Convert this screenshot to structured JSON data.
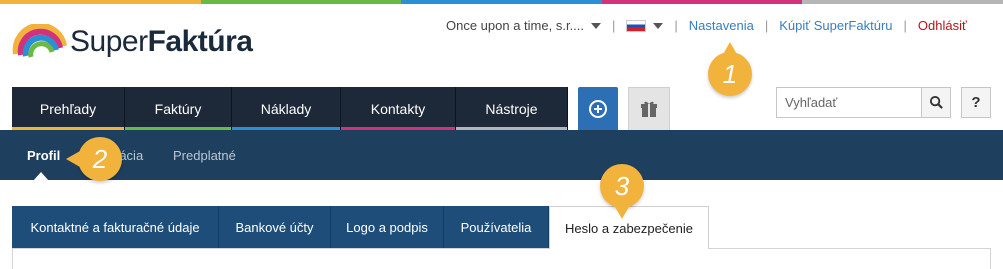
{
  "brand": {
    "name_light": "Super",
    "name_bold": "Faktúra",
    "stripe_colors": [
      "#f2b33d",
      "#6ab945",
      "#2b8fd6",
      "#d2327a",
      "#b5b5b5"
    ]
  },
  "topnav": {
    "company": "Once upon a time, s.r....",
    "separator": "|",
    "language_flag": "slovakia-flag-icon",
    "settings": "Nastavenia",
    "buy": "Kúpiť SuperFaktúru",
    "logout": "Odhlásiť"
  },
  "callouts": [
    "1",
    "2",
    "3"
  ],
  "mainnav": [
    {
      "label": "Prehľady",
      "color": "#f2b33d"
    },
    {
      "label": "Faktúry",
      "color": "#6ab945"
    },
    {
      "label": "Náklady",
      "color": "#2b8fd6"
    },
    {
      "label": "Kontakty",
      "color": "#d2327a"
    },
    {
      "label": "Nástroje",
      "color": "#b5b5b5"
    }
  ],
  "actions": {
    "add_icon": "plus-circle-icon",
    "gift_icon": "gift-icon"
  },
  "search": {
    "placeholder": "Vyhľadať",
    "icon": "search-icon"
  },
  "help": {
    "label": "?"
  },
  "subnav": {
    "items": [
      "Profil",
      "Integrácia",
      "Predplatné"
    ],
    "visible_fragment": "rácia",
    "active": "Profil"
  },
  "tabs": {
    "items": [
      "Kontaktné a fakturačné údaje",
      "Bankové účty",
      "Logo a podpis",
      "Používatelia",
      "Heslo a zabezpečenie"
    ],
    "active": "Heslo a zabezpečenie"
  },
  "colors": {
    "nav_dark": "#1d2838",
    "subbar": "#1e3f5e",
    "tab_blue": "#1e4d7a",
    "accent_blue": "#2c6fb5",
    "callout": "#f2b33d",
    "logout_red": "#b0161c",
    "link_blue": "#3a7dbf"
  }
}
